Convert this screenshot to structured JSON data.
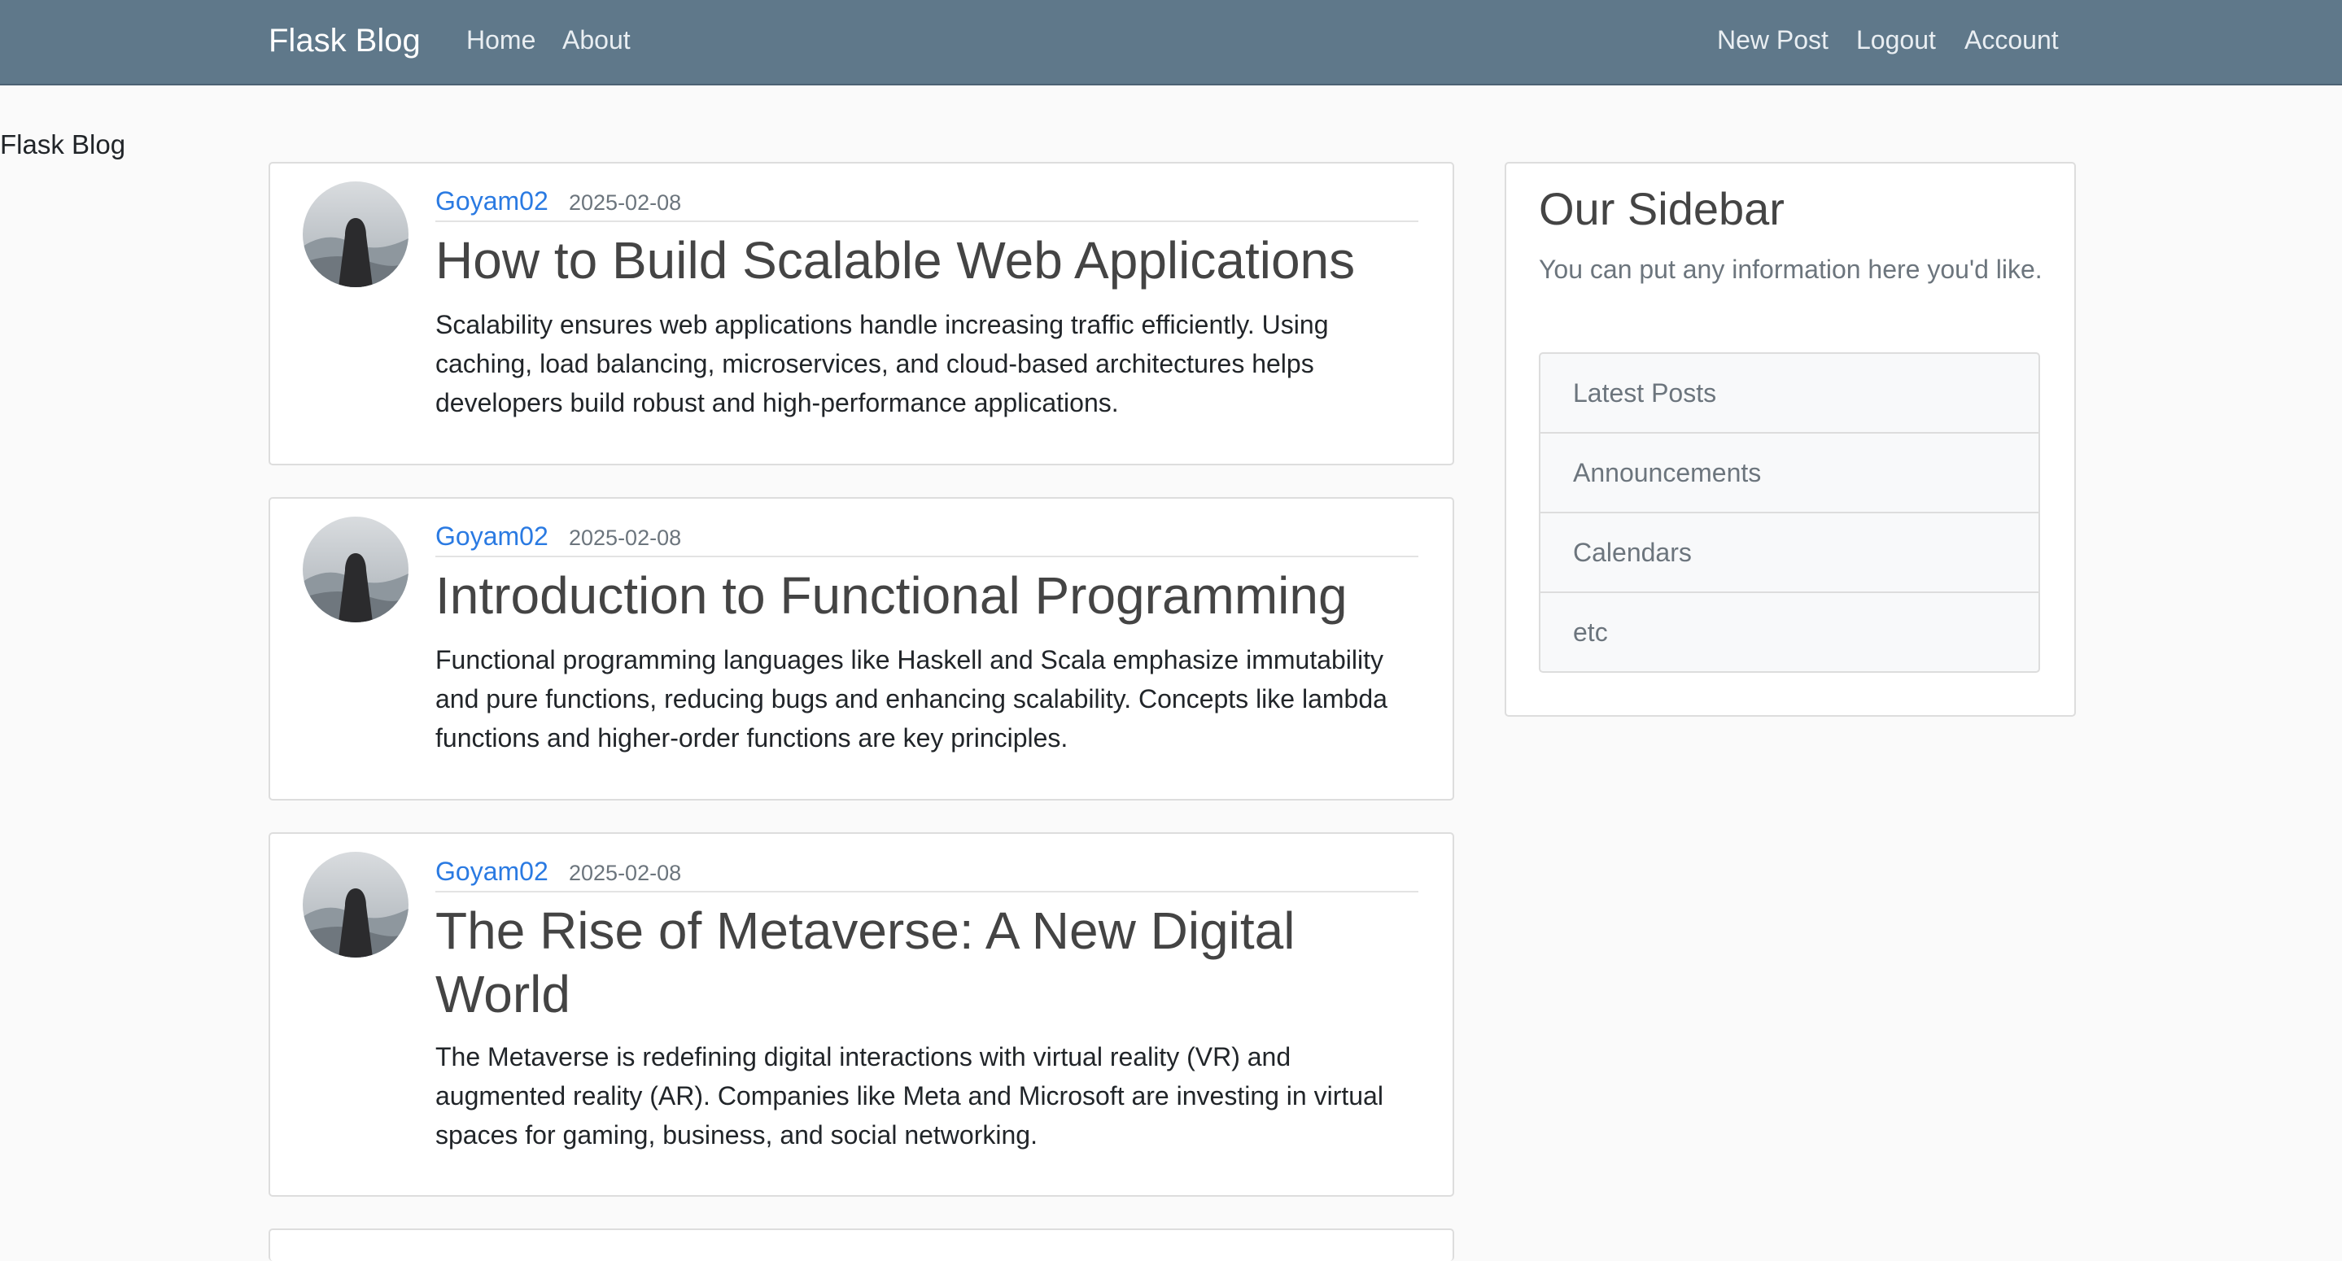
{
  "navbar": {
    "brand": "Flask Blog",
    "left_links": [
      "Home",
      "About"
    ],
    "right_links": [
      "New Post",
      "Logout",
      "Account"
    ]
  },
  "page": {
    "label": "Flask Blog"
  },
  "posts": [
    {
      "author": "Goyam02",
      "date": "2025-02-08",
      "title": "How to Build Scalable Web Applications",
      "content": "Scalability ensures web applications handle increasing traffic efficiently. Using caching, load balancing, microservices, and cloud-based architectures helps developers build robust and high-performance applications."
    },
    {
      "author": "Goyam02",
      "date": "2025-02-08",
      "title": "Introduction to Functional Programming",
      "content": "Functional programming languages like Haskell and Scala emphasize immutability and pure functions, reducing bugs and enhancing scalability. Concepts like lambda functions and higher-order functions are key principles."
    },
    {
      "author": "Goyam02",
      "date": "2025-02-08",
      "title": "The Rise of Metaverse: A New Digital World",
      "content": "The Metaverse is redefining digital interactions with virtual reality (VR) and augmented reality (AR). Companies like Meta and Microsoft are investing in virtual spaces for gaming, business, and social networking."
    }
  ],
  "sidebar": {
    "title": "Our Sidebar",
    "text": "You can put any information here you'd like.",
    "items": [
      "Latest Posts",
      "Announcements",
      "Calendars",
      "etc"
    ]
  },
  "colors": {
    "navbar": "#5f788a",
    "link": "#2a7ae2",
    "background": "#fafafa"
  }
}
